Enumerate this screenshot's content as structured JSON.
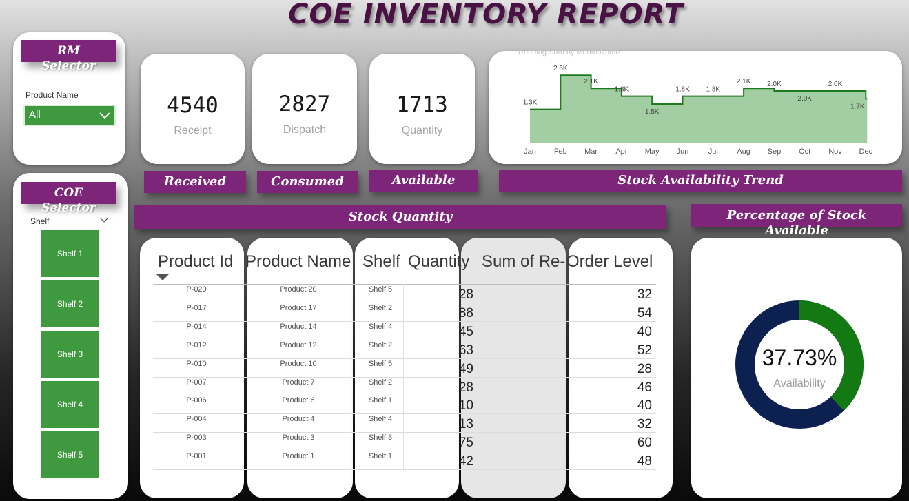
{
  "title": "COE INVENTORY REPORT",
  "rm_selector": {
    "header_line1": "RM",
    "header_line2": "Selector",
    "field_label": "Product Name",
    "selected": "All"
  },
  "coe_selector": {
    "header_line1": "COE",
    "header_line2": "Selector",
    "field_label": "Shelf",
    "shelves": [
      "Shelf 1",
      "Shelf 2",
      "Shelf 3",
      "Shelf 4",
      "Shelf 5"
    ]
  },
  "kpis": [
    {
      "value": "4540",
      "caption": "Receipt",
      "label": "Received"
    },
    {
      "value": "2827",
      "caption": "Dispatch",
      "label": "Consumed"
    },
    {
      "value": "1713",
      "caption": "Quantity",
      "label": "Available"
    }
  ],
  "trend": {
    "label": "Stock Availability Trend",
    "subtitle": "Running Sum by Month Name",
    "color": "#1e7a1e",
    "fill": "#a3cda3"
  },
  "chart_data": {
    "type": "area",
    "title": "Running Sum by Month Name",
    "categories": [
      "Jan",
      "Feb",
      "Mar",
      "Apr",
      "May",
      "Jun",
      "Jul",
      "Aug",
      "Sep",
      "Oct",
      "Nov",
      "Dec"
    ],
    "values": [
      1300,
      2600,
      2100,
      1800,
      1500,
      1800,
      1800,
      2100,
      2000,
      2000,
      2000,
      1700
    ],
    "data_labels": [
      "1.3K",
      "2.6K",
      "2.1K",
      "1.8K",
      "1.5K",
      "1.8K",
      "1.8K",
      "2.1K",
      "2.0K",
      "2.0K",
      "2.0K",
      "1.7K"
    ],
    "ylim": [
      0,
      3000
    ],
    "grid": false,
    "step": true
  },
  "stock_quantity": {
    "label": "Stock Quantity",
    "columns": [
      "Product Id",
      "Product Name",
      "Shelf",
      "Quantity",
      "Sum of Re-",
      "Order Level"
    ],
    "rows": [
      {
        "id": "P-020",
        "name": "Product 20",
        "shelf": "Shelf 5",
        "qty": "28",
        "reorder": "32"
      },
      {
        "id": "P-017",
        "name": "Product 17",
        "shelf": "Shelf 2",
        "qty": "88",
        "reorder": "54"
      },
      {
        "id": "P-014",
        "name": "Product 14",
        "shelf": "Shelf 4",
        "qty": "45",
        "reorder": "40"
      },
      {
        "id": "P-012",
        "name": "Product 12",
        "shelf": "Shelf 2",
        "qty": "63",
        "reorder": "52"
      },
      {
        "id": "P-010",
        "name": "Product 10",
        "shelf": "Shelf 5",
        "qty": "49",
        "reorder": "28"
      },
      {
        "id": "P-007",
        "name": "Product 7",
        "shelf": "Shelf 2",
        "qty": "28",
        "reorder": "46"
      },
      {
        "id": "P-006",
        "name": "Product 6",
        "shelf": "Shelf 1",
        "qty": "10",
        "reorder": "40"
      },
      {
        "id": "P-004",
        "name": "Product 4",
        "shelf": "Shelf 4",
        "qty": "13",
        "reorder": "32"
      },
      {
        "id": "P-003",
        "name": "Product 3",
        "shelf": "Shelf 3",
        "qty": "75",
        "reorder": "60"
      },
      {
        "id": "P-001",
        "name": "Product 1",
        "shelf": "Shelf 1",
        "qty": "42",
        "reorder": "48"
      }
    ]
  },
  "percentage": {
    "label_line1": "Percentage of Stock",
    "label_line2": "Available",
    "value": "37.73%",
    "caption": "Availability",
    "fraction": 0.3773,
    "available_color": "#137a13",
    "remaining_color": "#0d2150"
  }
}
